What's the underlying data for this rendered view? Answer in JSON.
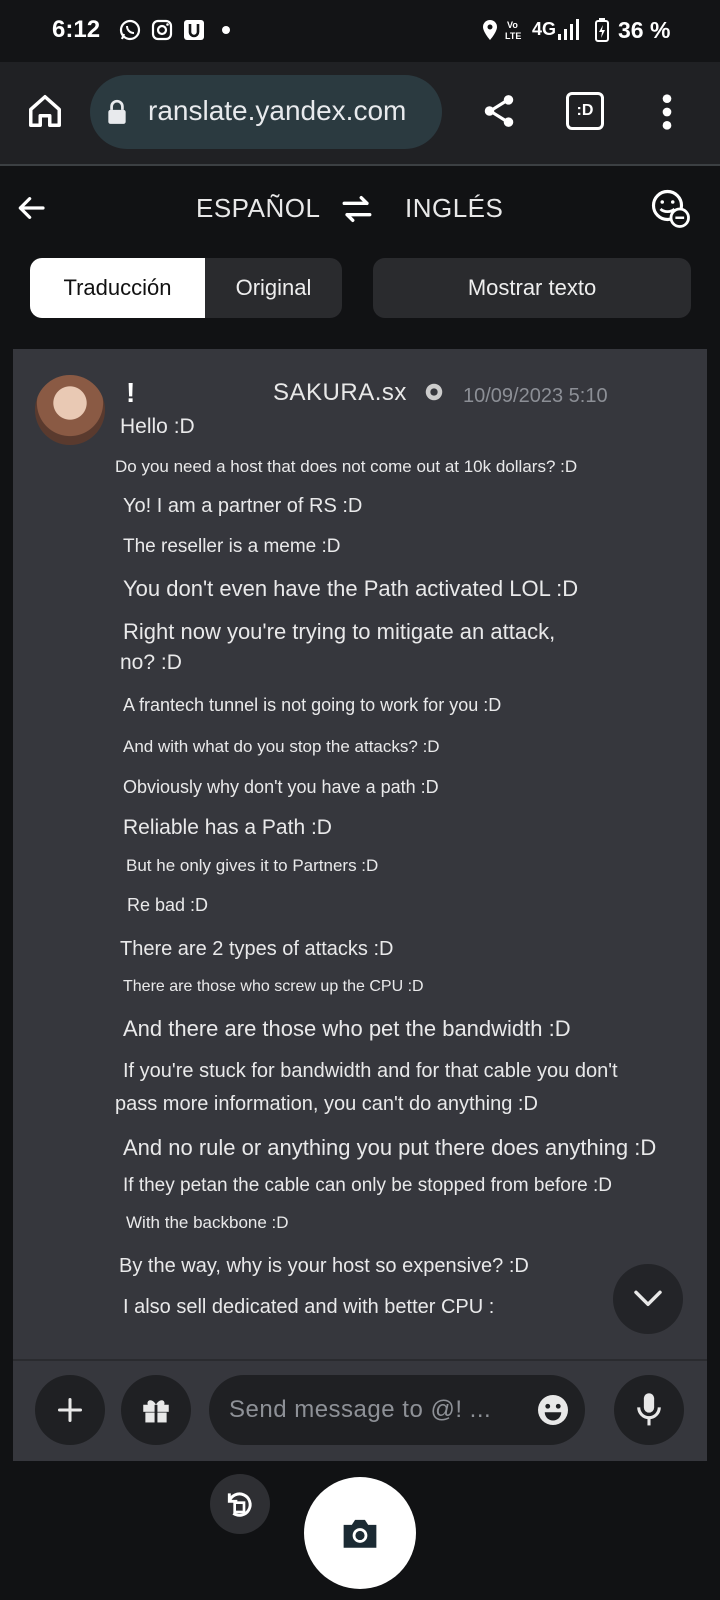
{
  "status_bar": {
    "time": "6:12",
    "battery_text": "36 %",
    "network": "4G",
    "icons": [
      "whatsapp-icon",
      "instagram-icon",
      "u-app-icon",
      "dot-icon",
      "location-icon",
      "volte-icon",
      "signal-icon",
      "battery-charging-icon"
    ]
  },
  "browser": {
    "url": "ranslate.yandex.com",
    "tab_icon_label": ":D"
  },
  "translator": {
    "source_lang": "ESPAÑOL",
    "target_lang": "INGLÉS",
    "tab_translation": "Traducción",
    "tab_original": "Original",
    "show_text": "Mostrar texto"
  },
  "chat": {
    "user_prefix": "!",
    "username": "SAKURA.sx",
    "timestamp": "10/09/2023 5:10",
    "messages": [
      "Hello :D",
      "Do you need a host that does not come out at 10k dollars? :D",
      "Yo! I am a partner of RS :D",
      "The reseller is a meme :D",
      "You don't even have the Path activated LOL :D",
      "Right now you're trying to mitigate an attack,",
      "no? :D",
      "A frantech tunnel is not going to work for you :D",
      "And with what do you stop the attacks? :D",
      "Obviously why don't you have a path :D",
      "Reliable has a Path :D",
      "But he only gives it to Partners :D",
      "Re bad :D",
      "There are 2 types of attacks :D",
      "There are those who screw up the CPU :D",
      "And there are those who pet the bandwidth :D",
      "If you're stuck for bandwidth and for that cable you don't",
      "pass more information, you can't do anything :D",
      "And no rule or anything you put there does anything :D",
      "If they petan the cable can only be stopped from before :D",
      "With the backbone :D",
      "By the way, why is your host so expensive? :D",
      "I also sell dedicated and with better CPU :"
    ]
  },
  "composer": {
    "placeholder": "Send message to @! ..."
  }
}
